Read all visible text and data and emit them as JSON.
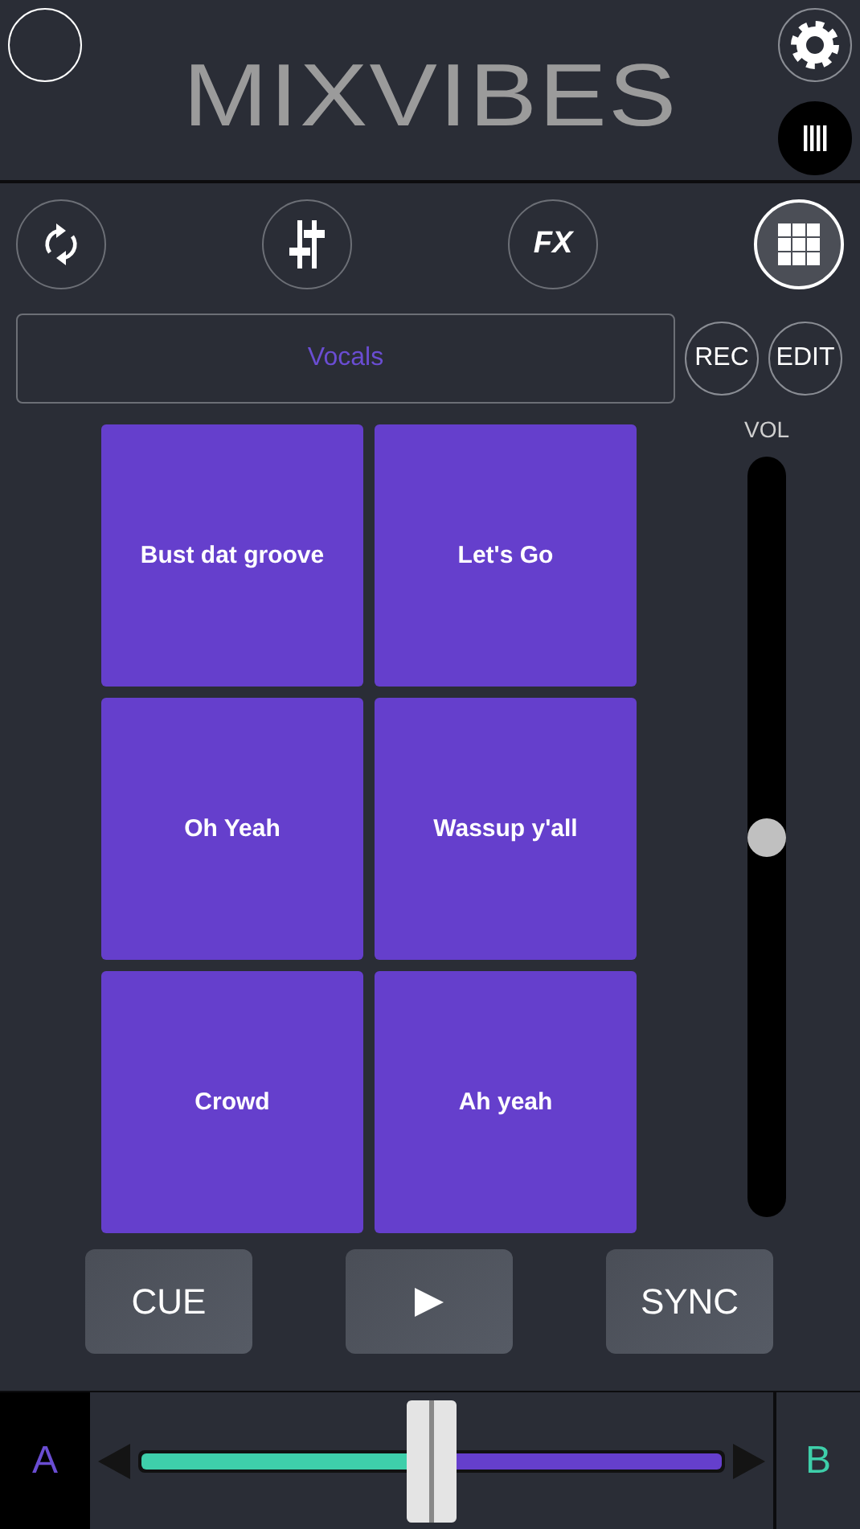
{
  "header": {
    "logo": "MIXVIBES"
  },
  "toolbar": [
    {
      "kind": "sync",
      "selected": false
    },
    {
      "kind": "mixer",
      "selected": false
    },
    {
      "kind": "fx",
      "label": "FX",
      "selected": false
    },
    {
      "kind": "pads",
      "selected": true
    }
  ],
  "bank": {
    "label": "Vocals"
  },
  "actions": [
    "REC",
    "EDIT"
  ],
  "volume": {
    "label": "VOL",
    "level": 0.5
  },
  "pads": [
    "Bust dat groove",
    "Let's Go",
    "Oh Yeah",
    "Wassup y'all",
    "Crowd",
    "Ah yeah"
  ],
  "transport": [
    {
      "kind": "text",
      "label": "CUE"
    },
    {
      "kind": "play"
    },
    {
      "kind": "text",
      "label": "SYNC"
    }
  ],
  "crossfader": {
    "left": "A",
    "right": "B",
    "level": 0.5
  }
}
